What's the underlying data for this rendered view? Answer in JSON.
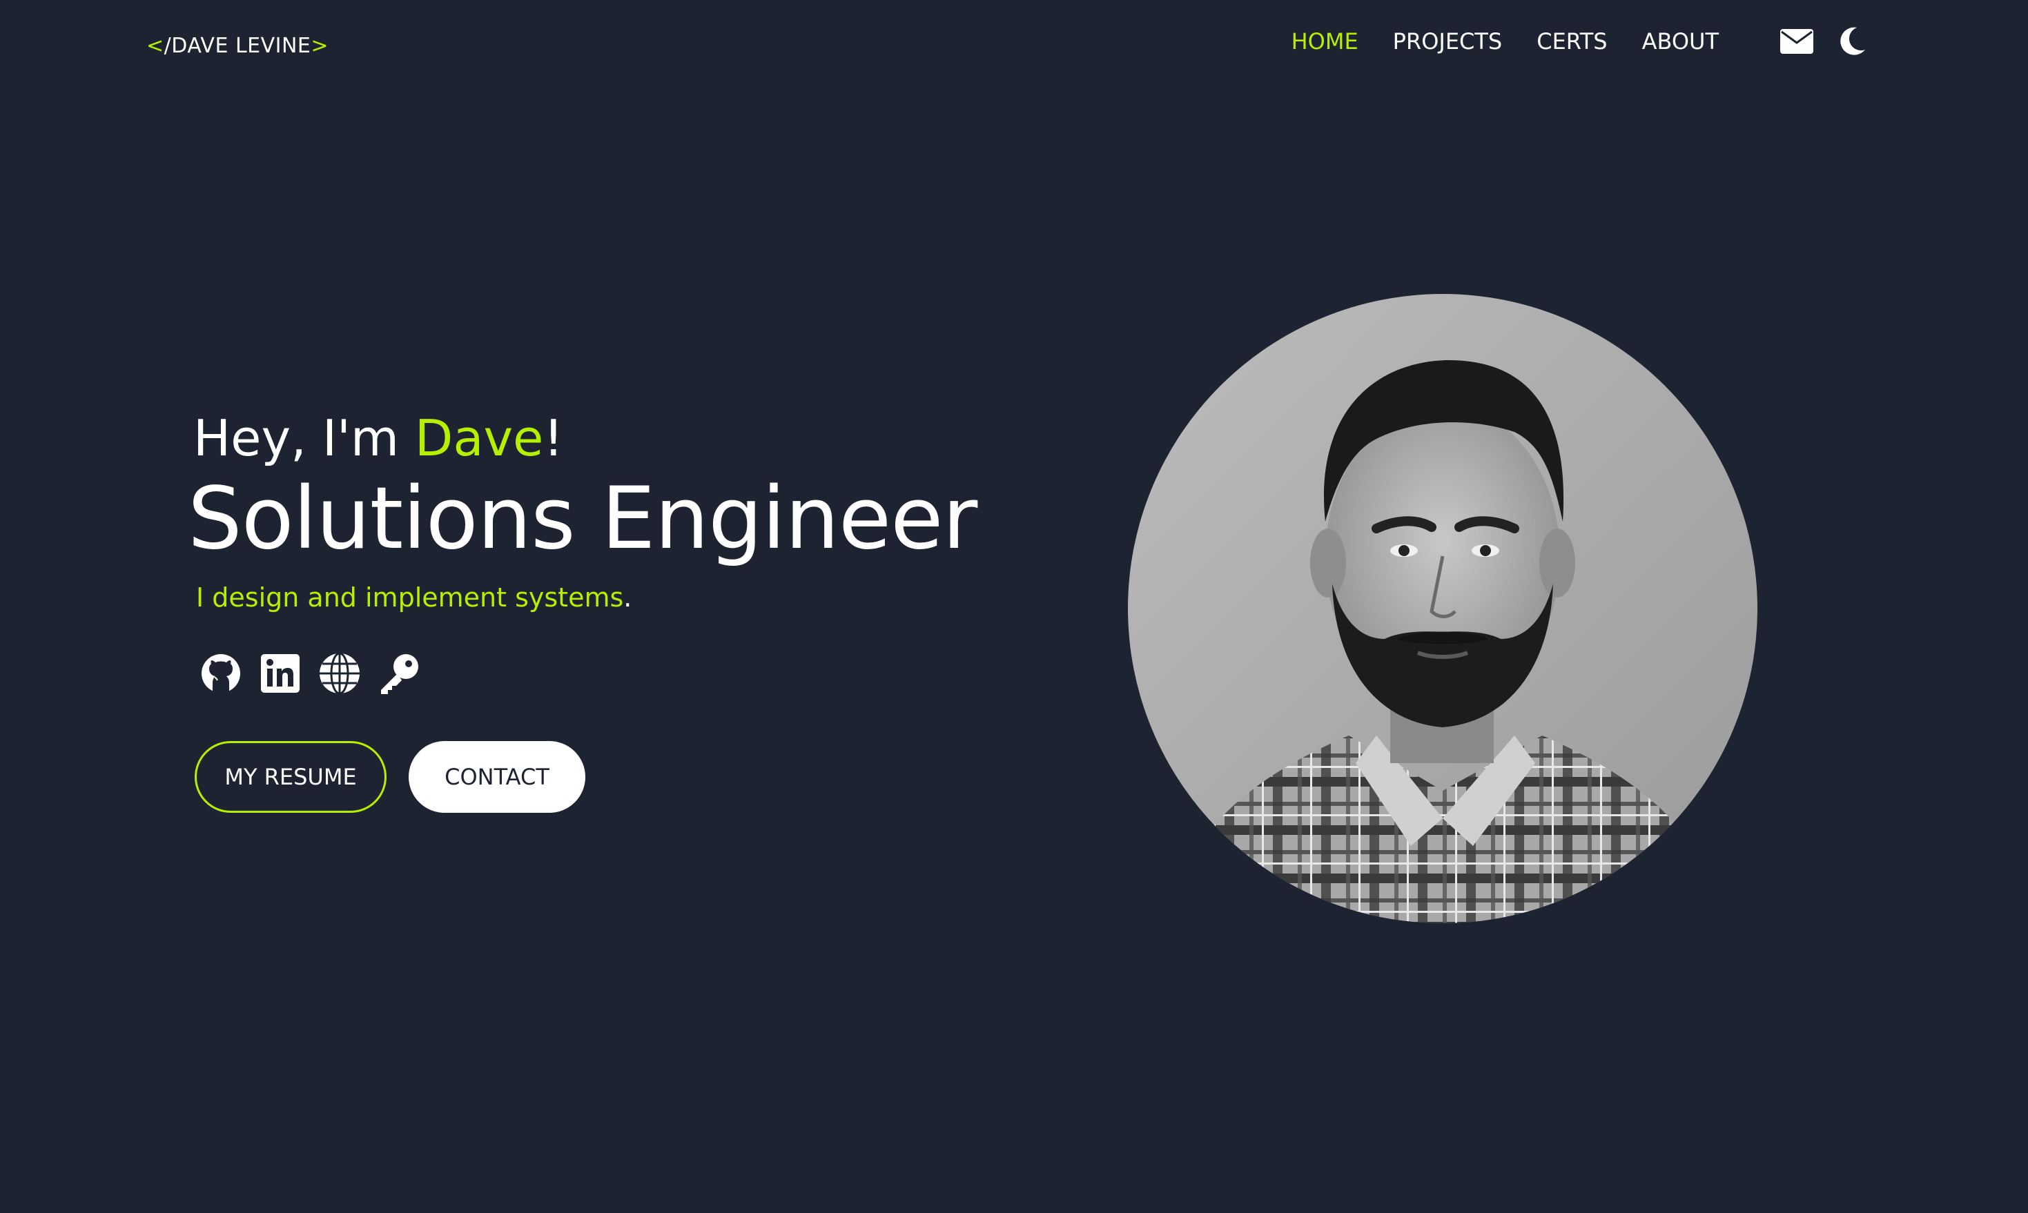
{
  "brand": {
    "open_bracket": "<",
    "slash": "/",
    "name": "DAVE LEVINE",
    "close_bracket": ">"
  },
  "nav": {
    "items": [
      {
        "label": "HOME",
        "active": true
      },
      {
        "label": "PROJECTS",
        "active": false
      },
      {
        "label": "CERTS",
        "active": false
      },
      {
        "label": "ABOUT",
        "active": false
      }
    ]
  },
  "header_icons": [
    "envelope-icon",
    "moon-icon"
  ],
  "hero": {
    "greeting_prefix": "Hey, I'm ",
    "greeting_name": "Dave",
    "greeting_suffix": "!",
    "role": "Solutions Engineer",
    "tagline": "I design and implement systems",
    "tagline_end": ".",
    "social_icons": [
      "github-icon",
      "linkedin-icon",
      "globe-icon",
      "key-icon"
    ],
    "buttons": {
      "resume": "MY RESUME",
      "contact": "CONTACT"
    }
  },
  "colors": {
    "background": "#1e2331",
    "accent": "#b6f000",
    "text": "#ffffff"
  }
}
